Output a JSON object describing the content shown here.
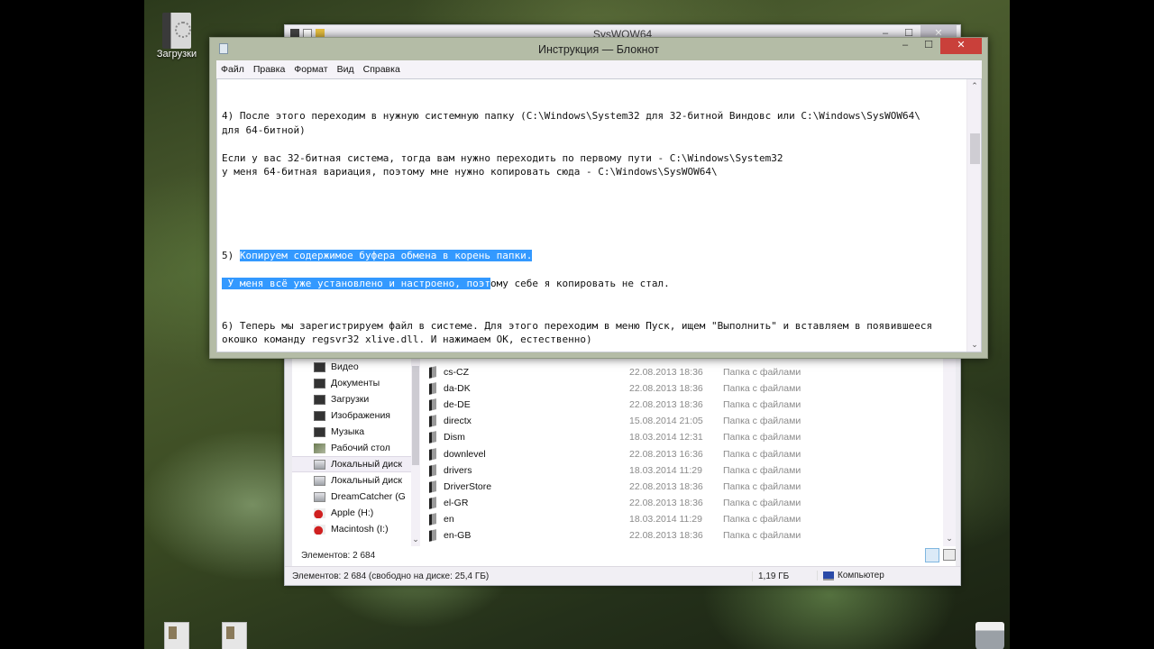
{
  "desktop": {
    "icons": [
      {
        "label": "Загрузки"
      },
      {
        "label": ""
      },
      {
        "label": ""
      },
      {
        "label": ""
      }
    ]
  },
  "explorer": {
    "title": "SysWOW64",
    "nav_items": [
      {
        "label": "Видео",
        "icon": "video-library-icon"
      },
      {
        "label": "Документы",
        "icon": "documents-library-icon"
      },
      {
        "label": "Загрузки",
        "icon": "downloads-library-icon"
      },
      {
        "label": "Изображения",
        "icon": "pictures-library-icon"
      },
      {
        "label": "Музыка",
        "icon": "music-library-icon"
      },
      {
        "label": "Рабочий стол",
        "icon": "desktop-icon"
      },
      {
        "label": "Локальный диск",
        "icon": "drive-icon"
      },
      {
        "label": "Локальный диск",
        "icon": "drive-icon"
      },
      {
        "label": "DreamCatcher (G",
        "icon": "drive-icon"
      },
      {
        "label": "Apple (H:)",
        "icon": "apple-drive-icon"
      },
      {
        "label": "Macintosh (I:)",
        "icon": "apple-drive-icon"
      }
    ],
    "files": [
      {
        "name": "cs-CZ",
        "date": "22.08.2013 18:36",
        "type": "Папка с файлами"
      },
      {
        "name": "da-DK",
        "date": "22.08.2013 18:36",
        "type": "Папка с файлами"
      },
      {
        "name": "de-DE",
        "date": "22.08.2013 18:36",
        "type": "Папка с файлами"
      },
      {
        "name": "directx",
        "date": "15.08.2014 21:05",
        "type": "Папка с файлами"
      },
      {
        "name": "Dism",
        "date": "18.03.2014 12:31",
        "type": "Папка с файлами"
      },
      {
        "name": "downlevel",
        "date": "22.08.2013 16:36",
        "type": "Папка с файлами"
      },
      {
        "name": "drivers",
        "date": "18.03.2014 11:29",
        "type": "Папка с файлами"
      },
      {
        "name": "DriverStore",
        "date": "22.08.2013 18:36",
        "type": "Папка с файлами"
      },
      {
        "name": "el-GR",
        "date": "22.08.2013 18:36",
        "type": "Папка с файлами"
      },
      {
        "name": "en",
        "date": "18.03.2014 11:29",
        "type": "Папка с файлами"
      },
      {
        "name": "en-GB",
        "date": "22.08.2013 18:36",
        "type": "Папка с файлами"
      }
    ],
    "inner_status": "Элементов: 2 684",
    "status": {
      "items": "Элементов: 2 684 (свободно на диске: 25,4 ГБ)",
      "size": "1,19 ГБ",
      "location": "Компьютер"
    }
  },
  "notepad": {
    "title": "Инструкция — Блокнот",
    "controls": {
      "minimize": "–",
      "maximize": "☐",
      "close": "✕"
    },
    "menu": [
      "Файл",
      "Правка",
      "Формат",
      "Вид",
      "Справка"
    ],
    "lines": [
      {
        "text": "4) После этого переходим в нужную системную папку (C:\\Windows\\System32 для 32-битной Виндовс или C:\\Windows\\SysWOW64\\"
      },
      {
        "text": "для 64-битной)"
      },
      {
        "text": ""
      },
      {
        "text": "Если у вас 32-битная система, тогда вам нужно переходить по первому пути - C:\\Windows\\System32"
      },
      {
        "text": "у меня 64-битная вариация, поэтому мне нужно копировать сюда - C:\\Windows\\SysWOW64\\"
      },
      {
        "text": ""
      },
      {
        "text": ""
      },
      {
        "text": ""
      },
      {
        "text": ""
      },
      {
        "text": ""
      },
      {
        "pre": "5) ",
        "sel": "Копируем содержимое буфера обмена в корень папки.",
        "post": ""
      },
      {
        "text": ""
      },
      {
        "pre": "",
        "sel": " У меня всё уже установлено и настроено, поэт",
        "post": "ому себе я копировать не стал."
      },
      {
        "text": ""
      },
      {
        "text": ""
      },
      {
        "text": "6) Теперь мы зарегистрируем файл в системе. Для этого переходим в меню Пуск, ищем \"Выполнить\" и вставляем в появившееся"
      },
      {
        "text": "окошко команду regsvr32 xlive.dll. И нажимаем OK, естественно)"
      }
    ],
    "selection_color": "#3399ff",
    "close_color": "#c9403a"
  }
}
